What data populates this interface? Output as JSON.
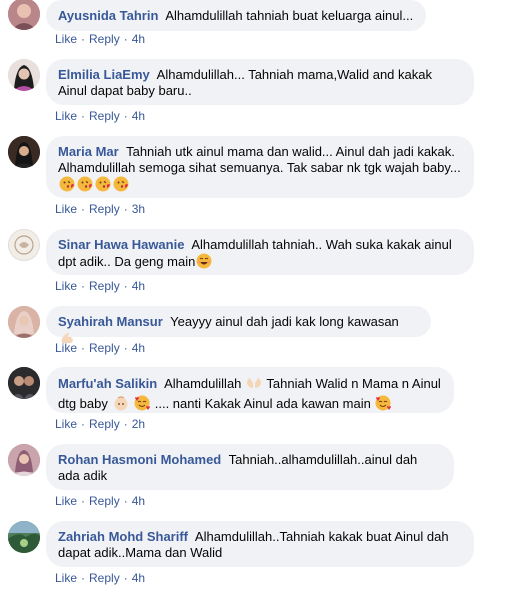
{
  "actions": {
    "like": "Like",
    "reply": "Reply",
    "separator": "·"
  },
  "comments": [
    {
      "author": "Ayusnida Tahrin",
      "text": "Alhamdulillah tahniah buat keluarga ainul...",
      "time": "4h",
      "avatar": {
        "icon": "profile-photo-icon",
        "bg": "#b9868a"
      }
    },
    {
      "author": "Elmilia LiaEmy",
      "text": "Alhamdulillah... Tahniah mama,Walid and kakak Ainul dapat baby baru..",
      "time": "4h",
      "avatar": {
        "icon": "profile-photo-icon",
        "bg": "#d9c9c4"
      }
    },
    {
      "author": "Maria Mar",
      "text": "Tahniah utk ainul mama dan walid... Ainul dah jadi kakak. Alhamdulillah semoga sihat semuanya. Tak sabar nk tgk wajah baby...",
      "time": "3h",
      "avatar": {
        "icon": "profile-photo-icon",
        "bg": "#3a2a24"
      },
      "emojis": [
        "kissing-face-emoji",
        "kissing-face-emoji",
        "kissing-face-emoji",
        "kissing-face-emoji"
      ]
    },
    {
      "author": "Sinar Hawa Hawanie",
      "text": "Alhamdulillah tahniah.. Wah suka kakak ainul dpt adik.. Da geng main",
      "time": "4h",
      "avatar": {
        "icon": "profile-photo-icon",
        "bg": "#ece5df"
      },
      "emojis": [
        "grinning-face-emoji"
      ]
    },
    {
      "author": "Syahirah Mansur",
      "text": "Yeayyy ainul dah jadi kak long kawasan",
      "time": "4h",
      "avatar": {
        "icon": "profile-photo-icon",
        "bg": "#c49a8c"
      },
      "emojis": [
        "flexed-biceps-emoji"
      ]
    },
    {
      "author": "Marfu'ah Salikin",
      "text_parts": [
        "Alhamdulillah",
        "Tahniah Walid n Mama n Ainul dtg baby",
        ".... nanti Kakak Ainul ada kawan main"
      ],
      "time": "2h",
      "avatar": {
        "icon": "profile-photo-icon",
        "bg": "#2b2b2e"
      },
      "emojis": [
        "open-hands-emoji",
        "baby-emoji",
        "smiling-face-hearts-emoji",
        "smiling-face-hearts-emoji"
      ]
    },
    {
      "author": "Rohan Hasmoni Mohamed",
      "text": "Tahniah..alhamdulillah..ainul dah ada adik",
      "time": "4h",
      "avatar": {
        "icon": "profile-photo-icon",
        "bg": "#a77a86"
      }
    },
    {
      "author": "Zahriah Mohd Shariff",
      "text": "Alhamdulillah..Tahniah kakak buat Ainul dah dapat adik..Mama dan Walid",
      "time": "4h",
      "avatar": {
        "icon": "profile-photo-icon",
        "bg": "#3d6b4a"
      }
    }
  ]
}
